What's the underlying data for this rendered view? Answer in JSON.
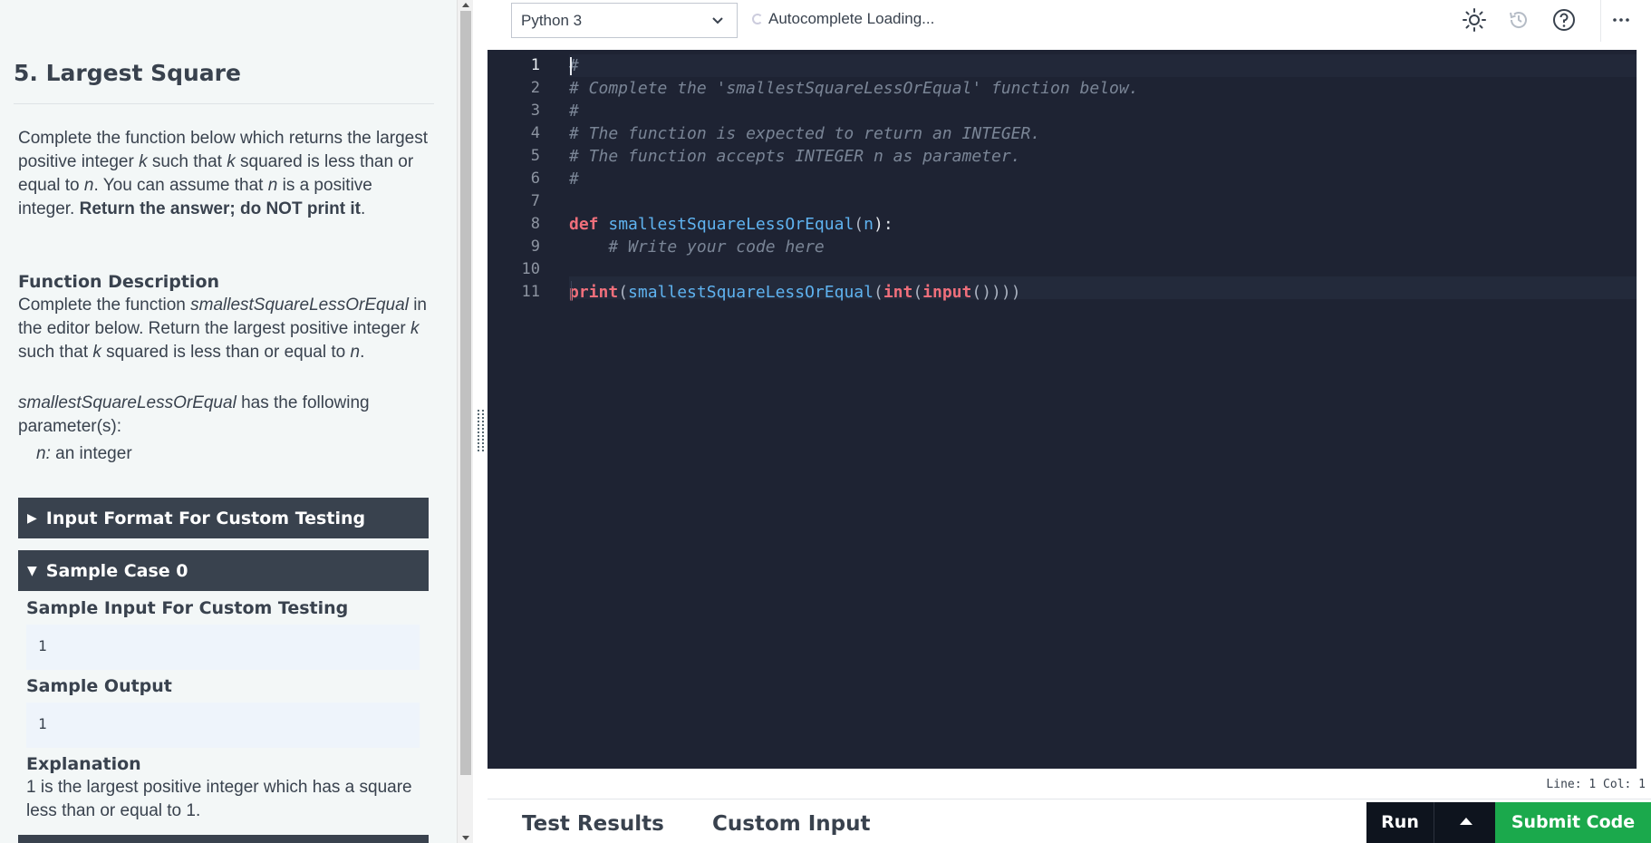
{
  "problem": {
    "title": "5. Largest Square",
    "intro_segments": [
      {
        "t": "Complete the function below which returns the largest positive integer ",
        "s": ""
      },
      {
        "t": "k",
        "s": "i"
      },
      {
        "t": " such that ",
        "s": ""
      },
      {
        "t": "k",
        "s": "i"
      },
      {
        "t": " squared is less than or equal to ",
        "s": ""
      },
      {
        "t": "n",
        "s": "i"
      },
      {
        "t": ". You can assume that ",
        "s": ""
      },
      {
        "t": "n",
        "s": "i"
      },
      {
        "t": " is a positive integer. ",
        "s": ""
      },
      {
        "t": "Return the answer; do NOT print it",
        "s": "b"
      },
      {
        "t": ".",
        "s": ""
      }
    ],
    "function_description_heading": "Function Description",
    "fd_line1_prefix": "Complete the function ",
    "fd_function_name": "smallestSquareLessOrEqual",
    "fd_line1_suffix": " in the editor below. Return the largest positive integer ",
    "fd_k": "k",
    "fd_mid": " such that ",
    "fd_k2": "k",
    "fd_end": " squared is less than or equal to ",
    "fd_n": "n",
    "fd_period": ".",
    "params_intro_suffix": " has the following parameter(s):",
    "param_name": "n:",
    "param_desc": " an integer",
    "accordion_input_format": "Input Format For Custom Testing",
    "accordion_sample_case": "Sample Case 0",
    "sample_input_heading": "Sample Input For Custom Testing",
    "sample_input_value": "1",
    "sample_output_heading": "Sample Output",
    "sample_output_value": "1",
    "explanation_heading": "Explanation",
    "explanation_text": "1 is the largest positive integer which has a square less than or equal to 1."
  },
  "toolbar": {
    "language": "Python 3",
    "autocomplete_status": "Autocomplete Loading...",
    "icons": [
      "theme-sun-icon",
      "history-icon",
      "help-icon",
      "more-icon"
    ]
  },
  "editor": {
    "line_numbers": [
      "1",
      "2",
      "3",
      "4",
      "5",
      "6",
      "7",
      "8",
      "9",
      "10",
      "11"
    ],
    "lines": [
      [
        {
          "t": "#",
          "c": "cm"
        }
      ],
      [
        {
          "t": "# Complete the 'smallestSquareLessOrEqual' function below.",
          "c": "cm"
        }
      ],
      [
        {
          "t": "#",
          "c": "cm"
        }
      ],
      [
        {
          "t": "# The function is expected to return an INTEGER.",
          "c": "cm"
        }
      ],
      [
        {
          "t": "# The function accepts INTEGER n as parameter.",
          "c": "cm"
        }
      ],
      [
        {
          "t": "#",
          "c": "cm"
        }
      ],
      [],
      [
        {
          "t": "def",
          "c": "kw"
        },
        {
          "t": " ",
          "c": "pl"
        },
        {
          "t": "smallestSquareLessOrEqual",
          "c": "fn"
        },
        {
          "t": "(",
          "c": "pn"
        },
        {
          "t": "n",
          "c": "fn"
        },
        {
          "t": "):",
          "c": "pl"
        }
      ],
      [
        {
          "t": "    ",
          "c": "pl"
        },
        {
          "t": "# Write your code here",
          "c": "cm"
        }
      ],
      [],
      [
        {
          "t": "print",
          "c": "kw"
        },
        {
          "t": "(",
          "c": "pn"
        },
        {
          "t": "smallestSquareLessOrEqual",
          "c": "fn"
        },
        {
          "t": "(",
          "c": "pn"
        },
        {
          "t": "int",
          "c": "kw"
        },
        {
          "t": "(",
          "c": "pn"
        },
        {
          "t": "input",
          "c": "kw"
        },
        {
          "t": "()))) ",
          "c": "pn"
        }
      ]
    ],
    "cursor_status": "Line: 1 Col: 1"
  },
  "bottom": {
    "tab_test_results": "Test Results",
    "tab_custom_input": "Custom Input",
    "run_label": "Run",
    "submit_label": "Submit Code"
  },
  "colors": {
    "editor_bg": "#1e2333",
    "accordion_bg": "#39424e",
    "submit_green": "#1ba94c",
    "run_dark": "#0e141e"
  }
}
